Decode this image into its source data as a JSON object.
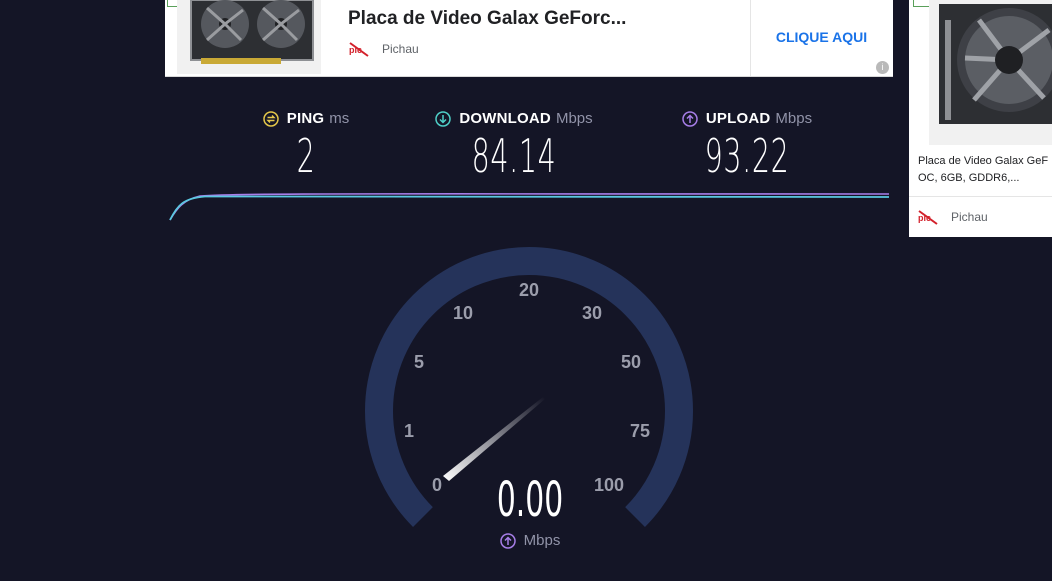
{
  "ad_top": {
    "title": "Placa de Video Galax GeForc...",
    "brand": "Pichau",
    "cta": "CLIQUE AQUI",
    "choice_icon": "i"
  },
  "ad_side": {
    "line1": "Placa de Video Galax GeF",
    "line2": "OC, 6GB, GDDR6,...",
    "brand": "Pichau"
  },
  "results": {
    "ping": {
      "label": "PING",
      "unit": "ms",
      "value": "2"
    },
    "download": {
      "label": "DOWNLOAD",
      "unit": "Mbps",
      "value": "84.14"
    },
    "upload": {
      "label": "UPLOAD",
      "unit": "Mbps",
      "value": "93.22"
    }
  },
  "gauge": {
    "ticks": [
      "0",
      "1",
      "5",
      "10",
      "20",
      "30",
      "50",
      "75",
      "100"
    ],
    "speed": "0.00",
    "unit": "Mbps"
  },
  "colors": {
    "background": "#141526",
    "ping_icon": "#e5c84a",
    "download_icon": "#4fd0c8",
    "upload_icon": "#a77ee8",
    "gauge_track": "#25335a",
    "cta": "#1a73e8"
  }
}
